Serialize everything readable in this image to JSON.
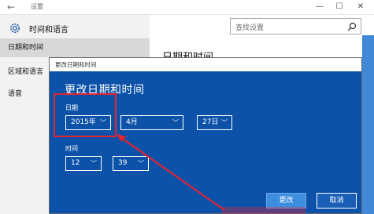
{
  "window": {
    "title": "设置",
    "back_glyph": "←",
    "minimize_glyph": "—",
    "maximize_glyph": "☐",
    "close_glyph": "✕"
  },
  "sidebar": {
    "header": "时间和语言",
    "items": [
      {
        "label": "日期和时间",
        "active": true
      },
      {
        "label": "区域和语言"
      },
      {
        "label": "语音"
      }
    ]
  },
  "main": {
    "search_placeholder": "查找设置",
    "page_title": "日期和时间"
  },
  "dialog": {
    "title": "更改日期和时间",
    "heading": "更改日期和时间",
    "date_label": "日期",
    "year": "2015年",
    "month": "4月",
    "day": "27日",
    "time_label": "时间",
    "hour": "12",
    "minute": "39",
    "change_button": "更改",
    "cancel_button": "取消",
    "chevron": "﹀"
  },
  "colors": {
    "dialog_bg": "#0d52a9",
    "primary_button": "#3e8ee0",
    "annotation": "#e8232e"
  }
}
